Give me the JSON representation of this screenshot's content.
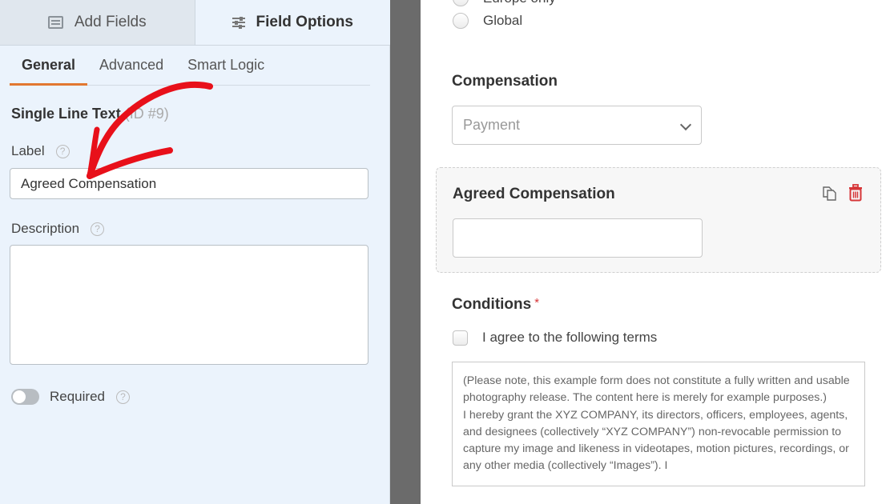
{
  "left_panel": {
    "tabs": [
      {
        "label": "Add Fields",
        "icon": "list-icon",
        "active": false
      },
      {
        "label": "Field Options",
        "icon": "sliders-icon",
        "active": true
      }
    ],
    "sub_tabs": [
      {
        "label": "General",
        "active": true
      },
      {
        "label": "Advanced",
        "active": false
      },
      {
        "label": "Smart Logic",
        "active": false
      }
    ],
    "field_type": "Single Line Text",
    "field_id": "(ID #9)",
    "label_field": {
      "label": "Label",
      "value": "Agreed Compensation"
    },
    "description_field": {
      "label": "Description",
      "value": ""
    },
    "required": {
      "label": "Required",
      "enabled": false
    },
    "help_glyph": "?",
    "annotation_color": "#e8101a",
    "accent_color": "#e27730"
  },
  "preview": {
    "radio_options": [
      "Europe only",
      "Global"
    ],
    "compensation": {
      "label": "Compensation",
      "placeholder": "Payment"
    },
    "selected_field": {
      "label": "Agreed Compensation",
      "value": ""
    },
    "conditions": {
      "label": "Conditions",
      "required_mark": "*",
      "checkbox_label": "I agree to the following terms",
      "checked": false,
      "terms": [
        "(Please note, this example form does not constitute a fully written and usable photography release. The content here is merely for example purposes.)",
        "I hereby grant the XYZ COMPANY, its directors, officers, employees, agents, and designees (collectively “XYZ COMPANY”) non-revocable permission to capture my image and likeness in videotapes, motion pictures, recordings, or any other media (collectively “Images”). I"
      ]
    },
    "delete_color": "#d63638"
  }
}
